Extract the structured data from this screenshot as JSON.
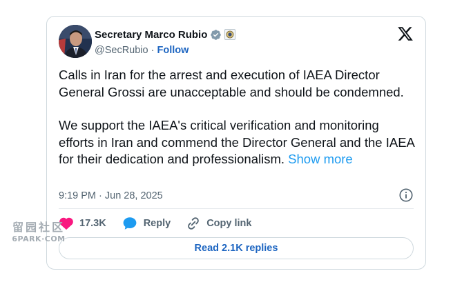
{
  "tweet": {
    "author_name": "Secretary Marco Rubio",
    "handle": "@SecRubio",
    "separator": " · ",
    "follow_label": "Follow",
    "paragraph1": "Calls in Iran for the arrest and execution of IAEA Director General Grossi are unacceptable and should be condemned.",
    "paragraph2": "We support the IAEA's critical verification and monitoring efforts in Iran and commend the Director General and the IAEA for their dedication and professionalism. ",
    "show_more_label": "Show more",
    "timestamp": "9:19 PM · Jun 28, 2025",
    "likes_count": "17.3K",
    "reply_label": "Reply",
    "copy_link_label": "Copy link",
    "read_replies_label": "Read 2.1K replies"
  },
  "watermark": {
    "top": "留园社区",
    "bottom": "6PARK·COM"
  },
  "colors": {
    "link_blue": "#1d9bf0",
    "follow_blue": "#1d65c1",
    "heart_pink": "#f91880",
    "muted_gray": "#536471",
    "border": "#cfd9de"
  },
  "icons": [
    "verified-badge-icon",
    "government-seal-icon",
    "x-logo-icon",
    "info-icon",
    "heart-icon",
    "reply-bubble-icon",
    "link-icon"
  ]
}
